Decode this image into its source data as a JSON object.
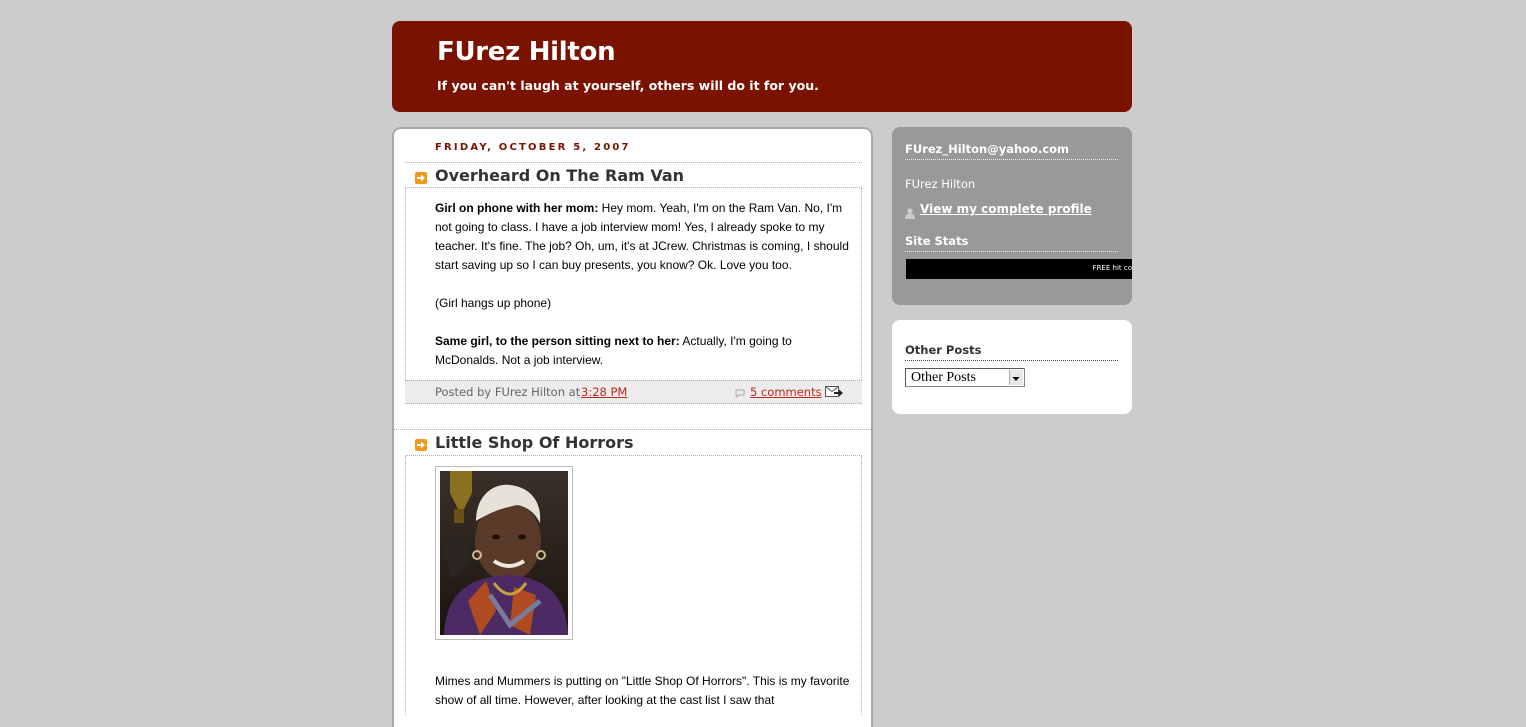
{
  "header": {
    "title": "FUrez Hilton",
    "description": "If you can't laugh at yourself, others will do it for you."
  },
  "posts": [
    {
      "date": "Friday, October 5, 2007",
      "title": "Overheard On The Ram Van",
      "p1_bold": "Girl on phone with her mom:",
      "p1_text": " Hey mom. Yeah, I'm on the Ram Van. No, I'm not going to class. I have a job interview mom! Yes, I already spoke to my teacher. It's fine. The job? Oh, um, it's at JCrew. Christmas is coming, I should start saving up so I can buy presents, you know? Ok. Love you too.",
      "p2_text": "(Girl hangs up phone)",
      "p3_bold": "Same girl, to the person sitting next to her:",
      "p3_text": " Actually, I'm going to McDonalds. Not a job interview.",
      "posted_by": "Posted by FUrez Hilton at",
      "time": "3:28 PM",
      "comments": "5 comments"
    },
    {
      "title": "Little Shop Of Horrors",
      "body_text": "Mimes and Mummers is putting on \"Little Shop Of Horrors\". This is my favorite show of all time. However, after looking at the cast list I saw that"
    }
  ],
  "sidebar": {
    "email_heading": "FUrez_Hilton@yahoo.com",
    "profile_name": "FUrez Hilton",
    "profile_link": "View my complete profile",
    "stats_heading": "Site Stats",
    "stats_banner": "FREE hit co",
    "other_heading": "Other Posts",
    "other_select": "Other Posts"
  },
  "colors": {
    "header_bg": "#7a1200",
    "page_bg": "#cccccc",
    "link": "#c0281a",
    "sidebar_bg": "#999999"
  }
}
